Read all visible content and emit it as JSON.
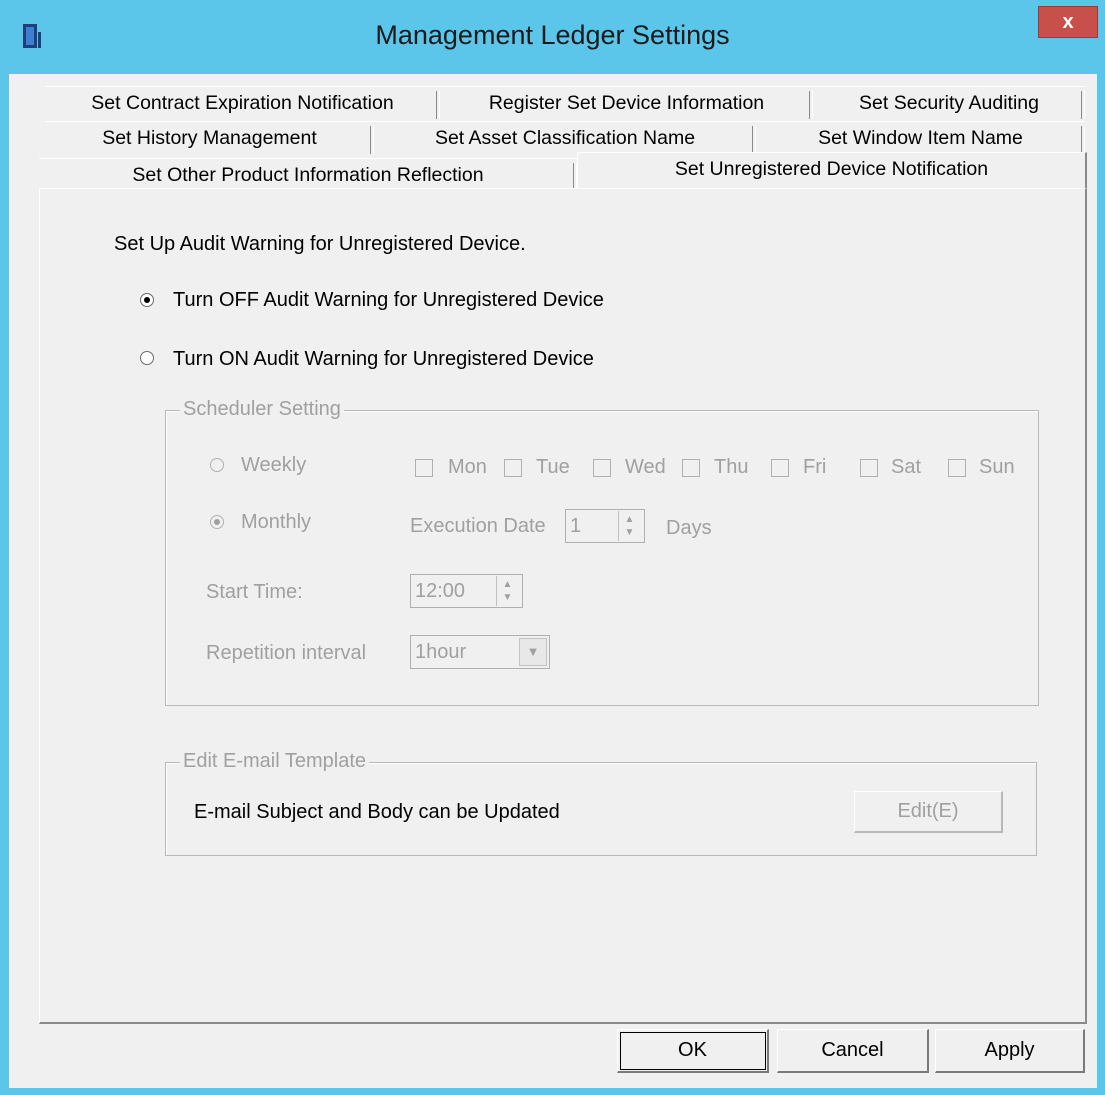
{
  "window": {
    "title": "Management Ledger Settings",
    "close_label": "x"
  },
  "tabs": {
    "row1": [
      "Set Contract Expiration Notification",
      "Register Set Device Information",
      "Set Security Auditing"
    ],
    "row2": [
      "Set History Management",
      "Set Asset Classification Name",
      "Set Window Item Name"
    ],
    "row3": [
      "Set Other Product Information Reflection",
      "Set Unregistered Device Notification"
    ],
    "active": "Set Unregistered Device Notification"
  },
  "audit": {
    "heading": "Set Up Audit Warning for Unregistered Device.",
    "off_label": "Turn OFF Audit Warning for Unregistered Device",
    "on_label": "Turn ON Audit Warning for Unregistered Device",
    "selected": "off"
  },
  "scheduler": {
    "title": "Scheduler Setting",
    "weekly_label": "Weekly",
    "monthly_label": "Monthly",
    "days": [
      "Mon",
      "Tue",
      "Wed",
      "Thu",
      "Fri",
      "Sat",
      "Sun"
    ],
    "execution_date_label": "Execution Date",
    "execution_date_value": "1",
    "days_suffix": "Days",
    "start_time_label": "Start Time:",
    "start_time_value": "12:00",
    "repetition_label": "Repetition interval",
    "repetition_value": "1hour",
    "selected": "monthly"
  },
  "email": {
    "title": "Edit E-mail Template",
    "description": "E-mail Subject and Body can be Updated",
    "edit_label": "Edit(E)"
  },
  "footer": {
    "ok_label": "OK",
    "cancel_label": "Cancel",
    "apply_label": "Apply"
  },
  "colors": {
    "title_bar": "#5cc5ea",
    "close_button": "#c7504a",
    "dialog_bg": "#f0f0f0",
    "disabled_text": "#a0a0a0"
  }
}
